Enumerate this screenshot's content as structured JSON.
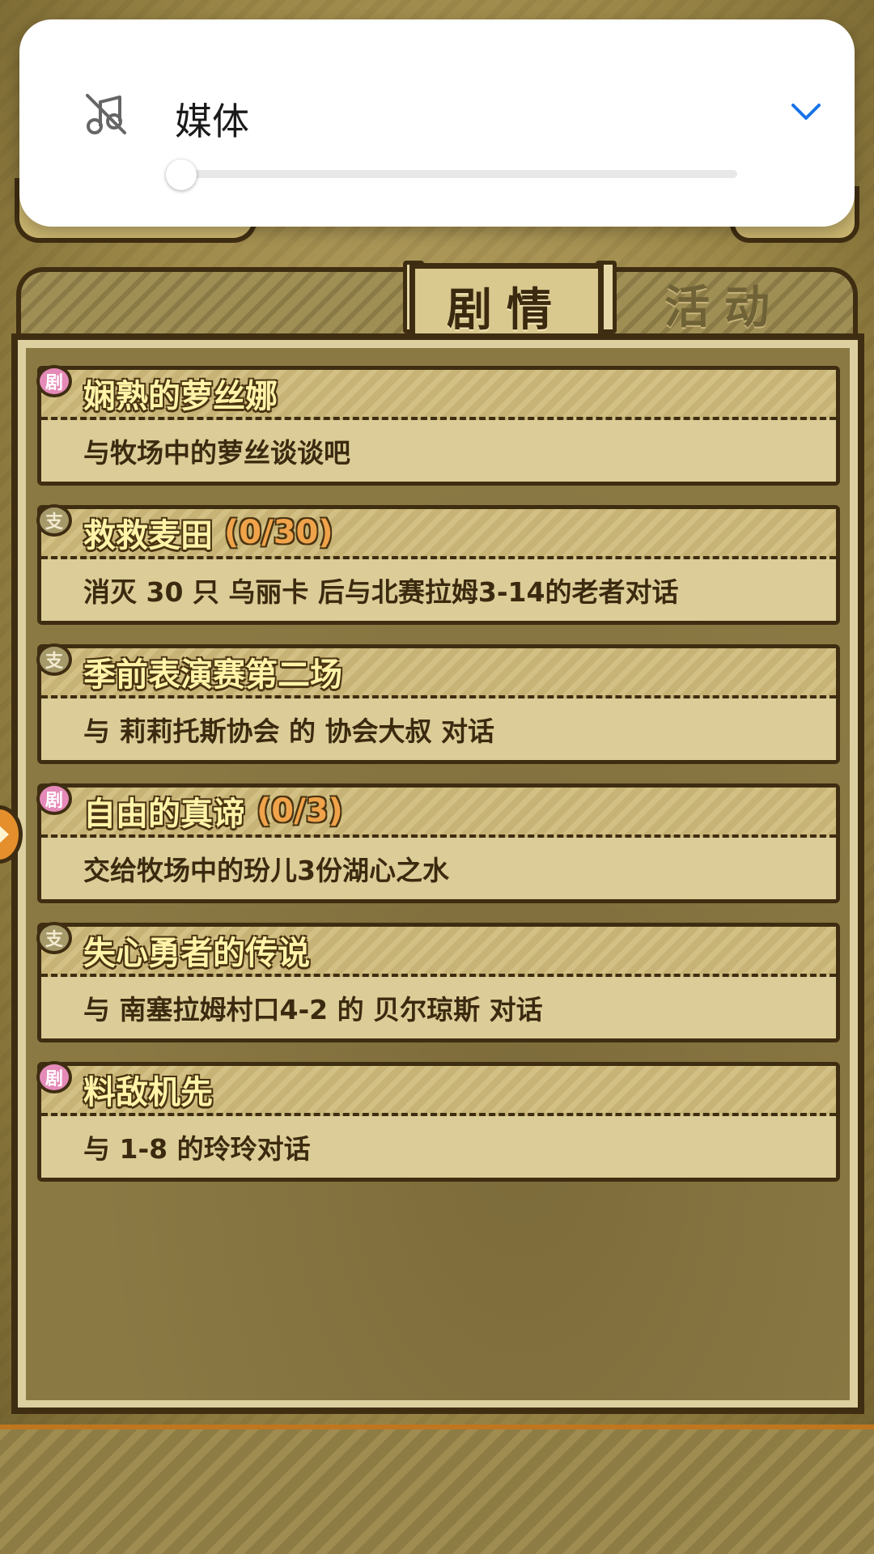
{
  "volume_panel": {
    "title": "媒体",
    "volume_level": 0,
    "muted": true,
    "mute_icon": "music-muted-icon",
    "expand_icon": "chevron-down-icon",
    "accent_color": "#1a73e8"
  },
  "tabs": {
    "story": "剧情",
    "activity": "活动",
    "active": "story"
  },
  "quests": [
    {
      "badge": "剧",
      "type": "main",
      "title": "娴熟的萝丝娜",
      "progress": "",
      "description": "与牧场中的萝丝谈谈吧"
    },
    {
      "badge": "支",
      "type": "side",
      "title": "救救麦田",
      "progress": "(0/30)",
      "description": "消灭 30 只 乌丽卡 后与北赛拉姆3-14的老者对话"
    },
    {
      "badge": "支",
      "type": "side",
      "title": "季前表演赛第二场",
      "progress": "",
      "description": "与 莉莉托斯协会 的 协会大叔 对话"
    },
    {
      "badge": "剧",
      "type": "main",
      "title": "自由的真谛",
      "progress": "(0/3)",
      "description": "交给牧场中的玢儿3份湖心之水"
    },
    {
      "badge": "支",
      "type": "side",
      "title": "失心勇者的传说",
      "progress": "",
      "description": "与 南塞拉姆村口4-2 的 贝尔琼斯 对话"
    },
    {
      "badge": "剧",
      "type": "main",
      "title": "料敌机先",
      "progress": "",
      "description": "与 1-8 的玲玲对话"
    }
  ]
}
